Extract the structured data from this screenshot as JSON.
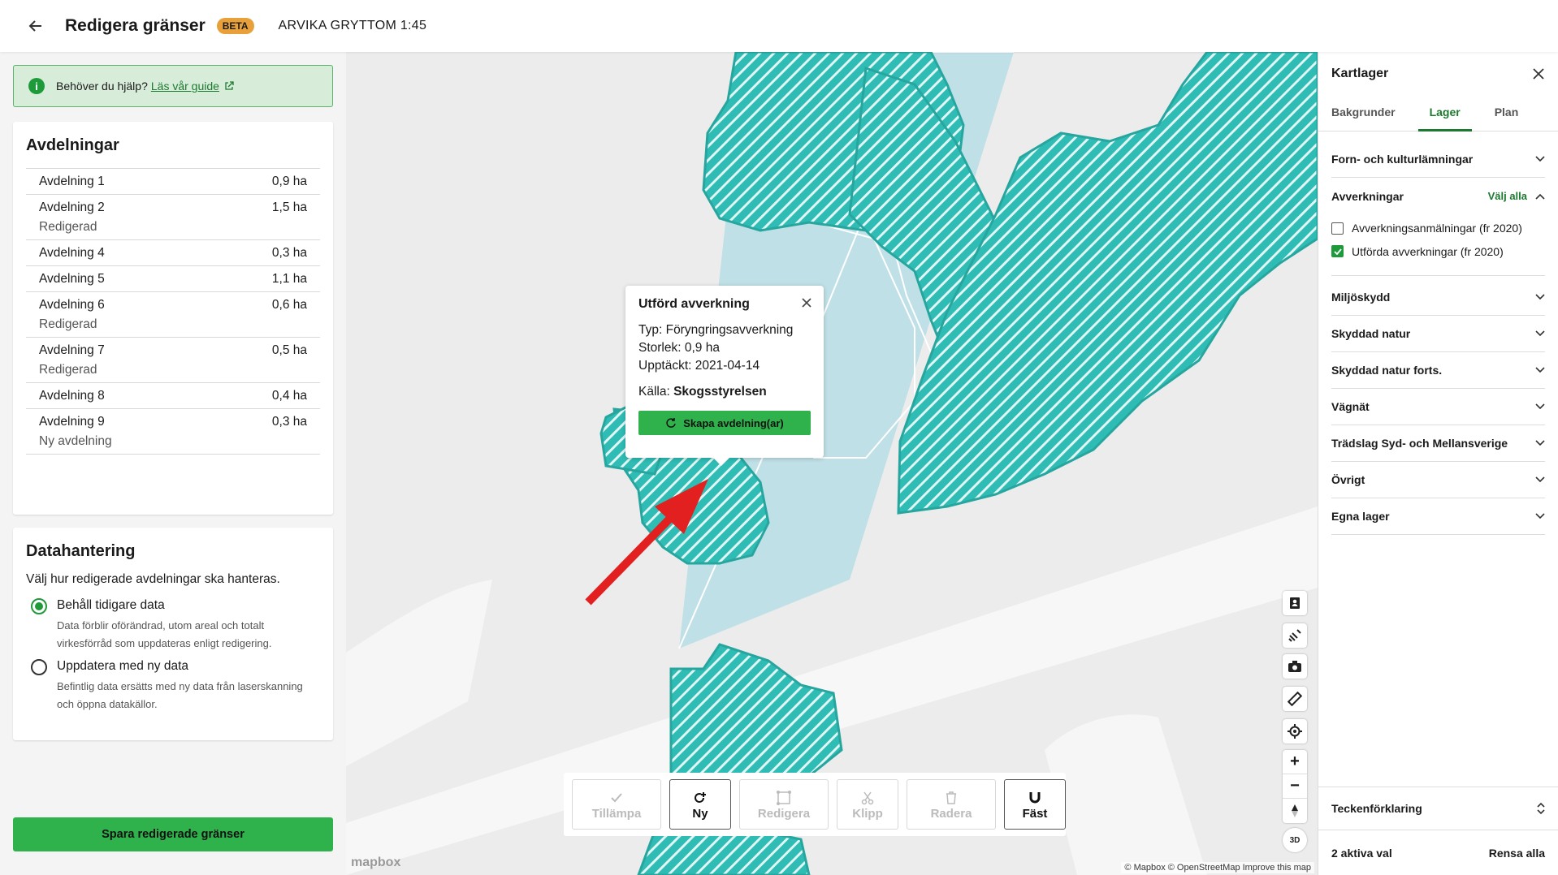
{
  "header": {
    "title": "Redigera gränser",
    "badge": "BETA",
    "subtitle": "ARVIKA GRYTTOM 1:45"
  },
  "help": {
    "text": "Behöver du hjälp?",
    "link": "Läs vår guide"
  },
  "divisions": {
    "title": "Avdelningar",
    "items": [
      {
        "name": "Avdelning 1",
        "area": "0,9 ha",
        "status": ""
      },
      {
        "name": "Avdelning 2",
        "area": "1,5 ha",
        "status": "Redigerad"
      },
      {
        "name": "Avdelning 4",
        "area": "0,3 ha",
        "status": ""
      },
      {
        "name": "Avdelning 5",
        "area": "1,1 ha",
        "status": ""
      },
      {
        "name": "Avdelning 6",
        "area": "0,6 ha",
        "status": "Redigerad"
      },
      {
        "name": "Avdelning 7",
        "area": "0,5 ha",
        "status": "Redigerad"
      },
      {
        "name": "Avdelning 8",
        "area": "0,4 ha",
        "status": ""
      },
      {
        "name": "Avdelning 9",
        "area": "0,3 ha",
        "status": "Ny avdelning"
      }
    ]
  },
  "data_handling": {
    "title": "Datahantering",
    "description": "Välj hur redigerade avdelningar ska hanteras.",
    "options": [
      {
        "title": "Behåll tidigare data",
        "desc": "Data förblir oförändrad, utom areal och totalt virkesförråd som uppdateras enligt redigering.",
        "selected": true
      },
      {
        "title": "Uppdatera med ny data",
        "desc": "Befintlig data ersätts med ny data från laserskanning och öppna datakällor.",
        "selected": false
      }
    ]
  },
  "save_label": "Spara redigerade gränser",
  "popup": {
    "title": "Utförd avverkning",
    "type": "Typ: Föryngringsavverkning",
    "size": "Storlek: 0,9 ha",
    "detected": "Upptäckt: 2021-04-14",
    "source_label": "Källa:",
    "source_value": "Skogsstyrelsen",
    "button": "Skapa avdelning(ar)"
  },
  "toolbar": {
    "apply": "Tillämpa",
    "new": "Ny",
    "edit": "Redigera",
    "cut": "Klipp",
    "delete": "Radera",
    "snap": "Fäst"
  },
  "map": {
    "attribution": "© Mapbox © OpenStreetMap  Improve this map",
    "logo": "mapbox",
    "buttons": [
      "contact-icon",
      "satellite-icon",
      "camera-icon",
      "ruler-icon",
      "locate-icon"
    ],
    "three_d": "3D",
    "colors": {
      "fill": "#2ebcb4",
      "light": "#bfe0e6",
      "road": "#f7f7f7",
      "arrow": "#e32020"
    }
  },
  "layers": {
    "title": "Kartlager",
    "tabs": [
      "Bakgrunder",
      "Lager",
      "Plan"
    ],
    "active_tab": "Lager",
    "sections": [
      "Forn- och kulturlämningar",
      "Avverkningar",
      "Miljöskydd",
      "Skyddad natur",
      "Skyddad natur forts.",
      "Vägnät",
      "Trädslag Syd- och Mellansverige",
      "Övrigt",
      "Egna lager"
    ],
    "select_all": "Välj alla",
    "checkboxes": [
      {
        "label": "Avverkningsanmälningar (fr 2020)",
        "checked": false
      },
      {
        "label": "Utförda avverkningar (fr 2020)",
        "checked": true
      }
    ],
    "legend": "Teckenförklaring",
    "active_count": "2 aktiva val",
    "clear_all": "Rensa alla"
  }
}
